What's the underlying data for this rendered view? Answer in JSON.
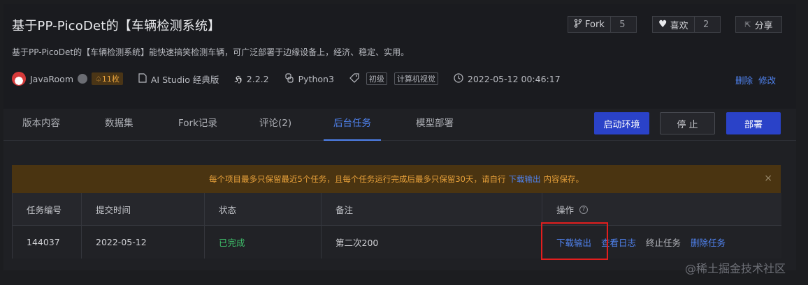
{
  "project": {
    "title": "基于PP-PicoDet的【车辆检测系统】",
    "description": "基于PP-PicoDet的【车辆检测系统】能快速搞笑检测车辆，可广泛部署于边缘设备上，经济、稳定、实用。"
  },
  "actions": {
    "fork_label": "Fork",
    "fork_count": "5",
    "like_label": "喜欢",
    "like_count": "2",
    "share_label": "分享"
  },
  "meta": {
    "author": "JavaRoom",
    "badge": "11枚",
    "platform": "AI Studio 经典版",
    "framework_version": "2.2.2",
    "language": "Python3",
    "tag_level": "初级",
    "tag_topic": "计算机视觉",
    "datetime": "2022-05-12 00:46:17",
    "delete_label": "删除",
    "edit_label": "修改"
  },
  "tabs": [
    {
      "label": "版本内容"
    },
    {
      "label": "数据集"
    },
    {
      "label": "Fork记录"
    },
    {
      "label": "评论(2)"
    },
    {
      "label": "后台任务"
    },
    {
      "label": "模型部署"
    }
  ],
  "buttons": {
    "start": "启动环境",
    "stop": "停 止",
    "deploy": "部署"
  },
  "notice": {
    "text_before": "每个项目最多只保留最近5个任务，且每个任务运行完成后最多只保留30天，请自行",
    "link": "下载输出",
    "text_after": "内容保存。",
    "close": "×"
  },
  "table": {
    "headers": [
      "任务编号",
      "提交时间",
      "状态",
      "备注",
      "操作"
    ],
    "row": {
      "id": "144037",
      "time": "2022-05-12",
      "status": "已完成",
      "note": "第二次200",
      "ops": [
        "下载输出",
        "查看日志",
        "终止任务",
        "删除任务"
      ]
    }
  },
  "watermark": "@稀土掘金技术社区",
  "colors": {
    "accent": "#4f82ee",
    "primary_button": "#2a42c8",
    "success": "#3fbf6a",
    "warning_bg": "#4a3411",
    "warning_text": "#e8a13a",
    "highlight": "#e21e1e"
  }
}
